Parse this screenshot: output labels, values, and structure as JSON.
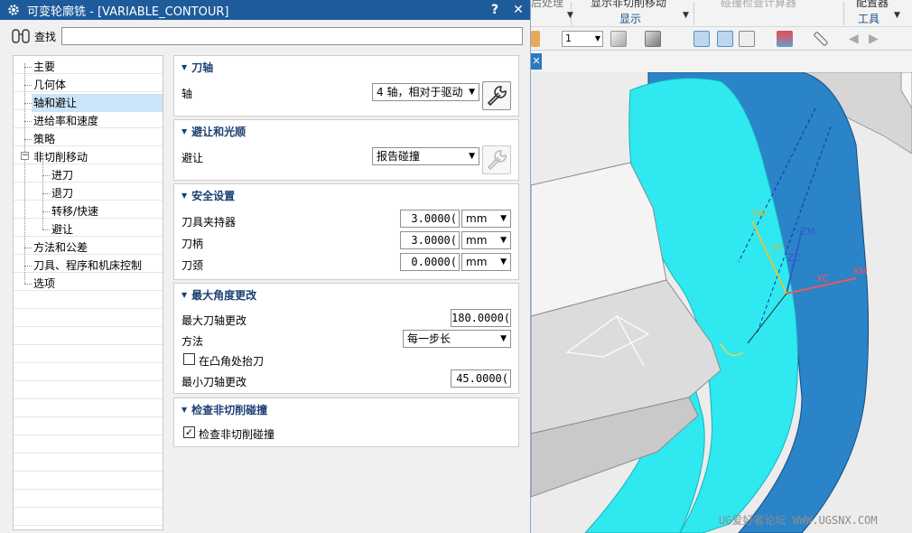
{
  "dialog": {
    "title": "可变轮廓铣 - [VARIABLE_CONTOUR]",
    "help": "?",
    "close": "✕",
    "search_label": "查找",
    "search_value": ""
  },
  "tree": [
    {
      "label": "主要"
    },
    {
      "label": "几何体"
    },
    {
      "label": "轴和避让",
      "selected": true
    },
    {
      "label": "进给率和速度"
    },
    {
      "label": "策略"
    },
    {
      "label": "非切削移动",
      "expanded": true
    },
    {
      "label": "进刀"
    },
    {
      "label": "退刀"
    },
    {
      "label": "转移/快速"
    },
    {
      "label": "避让"
    },
    {
      "label": "方法和公差"
    },
    {
      "label": "刀具、程序和机床控制"
    },
    {
      "label": "选项"
    }
  ],
  "tree_expander": "−",
  "sections": {
    "tool_axis": {
      "title": "刀轴",
      "axis_label": "轴",
      "axis_value": "4 轴，相对于驱动"
    },
    "avoid": {
      "title": "避让和光顺",
      "avoid_label": "避让",
      "avoid_value": "报告碰撞"
    },
    "safety": {
      "title": "安全设置",
      "rows": [
        {
          "label": "刀具夹持器",
          "value": "3.0000(",
          "unit": "mm"
        },
        {
          "label": "刀柄",
          "value": "3.0000(",
          "unit": "mm"
        },
        {
          "label": "刀颈",
          "value": "0.0000(",
          "unit": "mm"
        }
      ]
    },
    "max_angle": {
      "title": "最大角度更改",
      "max_label": "最大刀轴更改",
      "max_value": "180.0000(",
      "method_label": "方法",
      "method_value": "每一步长",
      "retract_label": "在凸角处抬刀",
      "retract_checked": false,
      "min_label": "最小刀轴更改",
      "min_value": "45.0000("
    },
    "check": {
      "title": "检查非切削碰撞",
      "check_label": "检查非切削碰撞",
      "check_checked": true
    }
  },
  "cad": {
    "ribbon_cut_left": "后处理",
    "ribbon_cut_mid": "显示非切削移动",
    "ribbon_cut_right": "碰撞检查计算器",
    "ribbon_cut_far": "配置器",
    "group_display": "显示",
    "group_tools": "工具",
    "layer_combo": "1",
    "close_tab": "✕",
    "axis_labels": {
      "yc": "YC",
      "ym": "YM",
      "zc": "ZC",
      "zm": "ZM",
      "xc": "XC",
      "xm": "XM"
    },
    "watermark": "UG爱好者论坛 WWW.UGSNX.COM",
    "colors": {
      "toolpath": "#2fe8f0",
      "part": "#2a7fc4",
      "block": "#f4f4f4"
    }
  }
}
